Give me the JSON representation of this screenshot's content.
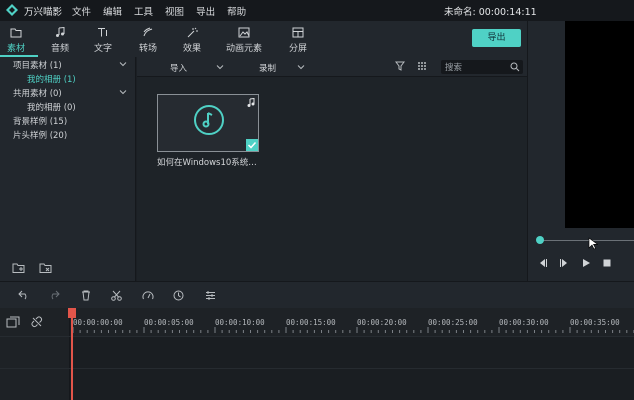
{
  "app": {
    "name": "万兴喵影"
  },
  "menu": [
    "文件",
    "编辑",
    "工具",
    "视图",
    "导出",
    "帮助"
  ],
  "project": {
    "title": "未命名: 00:00:14:11"
  },
  "toolbar": {
    "tabs": [
      {
        "label": "素材",
        "icon": "folder-icon"
      },
      {
        "label": "音频",
        "icon": "music-note-icon"
      },
      {
        "label": "文字",
        "icon": "text-icon"
      },
      {
        "label": "转场",
        "icon": "transition-icon"
      },
      {
        "label": "效果",
        "icon": "sparkle-effect-icon"
      },
      {
        "label": "动画元素",
        "icon": "image-element-icon"
      },
      {
        "label": "分屏",
        "icon": "split-screen-icon"
      }
    ],
    "export_label": "导出"
  },
  "library": {
    "items": [
      {
        "label": "项目素材 (1)"
      },
      {
        "label": "我的相册 (1)"
      },
      {
        "label": "共用素材 (0)"
      },
      {
        "label": "我的相册 (0)"
      },
      {
        "label": "背景样例 (15)"
      },
      {
        "label": "片头样例 (20)"
      }
    ]
  },
  "media": {
    "import_label": "导入",
    "record_label": "录制",
    "search_placeholder": "搜索",
    "clips": [
      {
        "name": "如何在Windows10系统…"
      }
    ]
  },
  "timeline": {
    "timestamps": [
      "00:00:00:00",
      "00:00:05:00",
      "00:00:10:00",
      "00:00:15:00",
      "00:00:20:00",
      "00:00:25:00",
      "00:00:30:00",
      "00:00:35:00"
    ]
  },
  "colors": {
    "accent": "#4fd1c5",
    "playhead": "#e2554a",
    "background": "#1b1f24"
  }
}
